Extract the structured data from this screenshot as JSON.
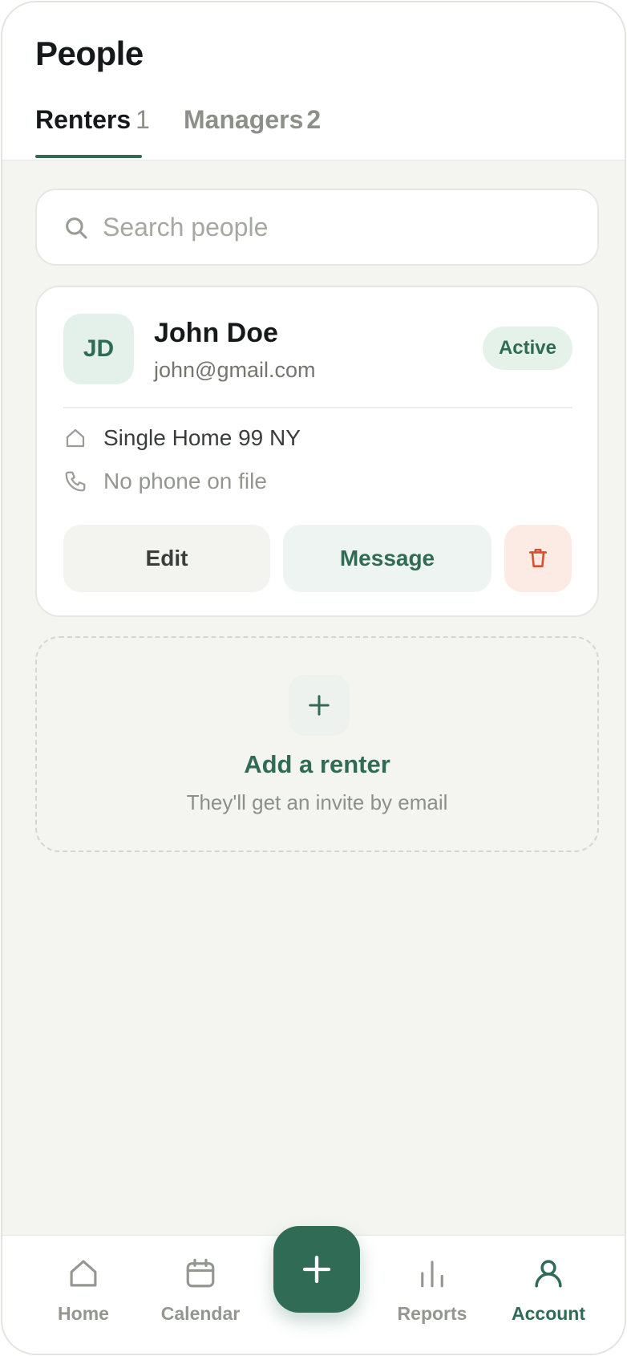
{
  "header": {
    "title": "People",
    "tabs": [
      {
        "label": "Renters",
        "count": "1",
        "active": true
      },
      {
        "label": "Managers",
        "count": "2",
        "active": false
      }
    ]
  },
  "search": {
    "placeholder": "Search people",
    "value": ""
  },
  "renter_card": {
    "initials": "JD",
    "name": "John Doe",
    "email": "john@gmail.com",
    "status": "Active",
    "property": "Single Home 99 NY",
    "phone": "No phone on file",
    "edit_label": "Edit",
    "message_label": "Message",
    "delete_icon": "trash-icon"
  },
  "add_renter": {
    "title": "Add a renter",
    "subtitle": "They'll get an invite by email"
  },
  "bottom_nav": {
    "items": [
      {
        "label": "Home",
        "icon": "home-icon"
      },
      {
        "label": "Calendar",
        "icon": "calendar-icon"
      },
      {
        "label": "Reports",
        "icon": "bar-chart-icon"
      },
      {
        "label": "Account",
        "icon": "user-icon",
        "active": true
      }
    ],
    "fab_icon": "plus-icon"
  },
  "colors": {
    "accent": "#2f6b55",
    "background": "#f4f5f1",
    "danger": "#d4502f",
    "muted": "#94978f"
  }
}
